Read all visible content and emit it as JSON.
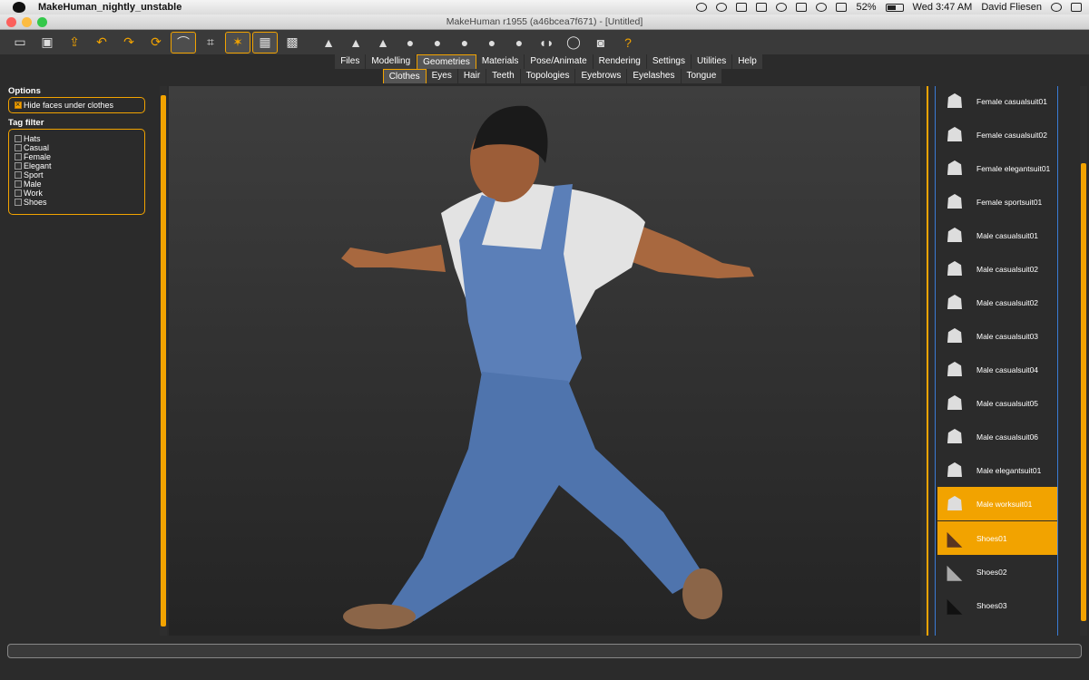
{
  "menubar": {
    "app_name": "MakeHuman_nightly_unstable",
    "battery": "52%",
    "clock": "Wed 3:47 AM",
    "user": "David Fliesen"
  },
  "window": {
    "title": "MakeHuman r1955 (a46bcea7f671) - [Untitled]"
  },
  "toolbar": {
    "buttons": [
      "undo-icon",
      "redo-icon",
      "reset-icon",
      "help-icon"
    ],
    "help_label": "?"
  },
  "tabs": {
    "main": [
      "Files",
      "Modelling",
      "Geometries",
      "Materials",
      "Pose/Animate",
      "Rendering",
      "Settings",
      "Utilities",
      "Help"
    ],
    "selected_main": "Geometries",
    "sub": [
      "Clothes",
      "Eyes",
      "Hair",
      "Teeth",
      "Topologies",
      "Eyebrows",
      "Eyelashes",
      "Tongue"
    ],
    "selected_sub": "Clothes"
  },
  "left": {
    "options_title": "Options",
    "hide_faces_label": "Hide faces under clothes",
    "tag_filter_title": "Tag filter",
    "tags": [
      "Hats",
      "Casual",
      "Female",
      "Elegant",
      "Sport",
      "Male",
      "Work",
      "Shoes"
    ]
  },
  "clothes": {
    "items": [
      "Female casualsuit01",
      "Female casualsuit02",
      "Female elegantsuit01",
      "Female sportsuit01",
      "Male casualsuit01",
      "Male casualsuit02",
      "Male casualsuit02",
      "Male casualsuit03",
      "Male casualsuit04",
      "Male casualsuit05",
      "Male casualsuit06",
      "Male elegantsuit01",
      "Male worksuit01",
      "Shoes01",
      "Shoes02",
      "Shoes03"
    ],
    "selected": [
      "Male worksuit01",
      "Shoes01"
    ]
  },
  "colors": {
    "accent": "#f2a300"
  }
}
